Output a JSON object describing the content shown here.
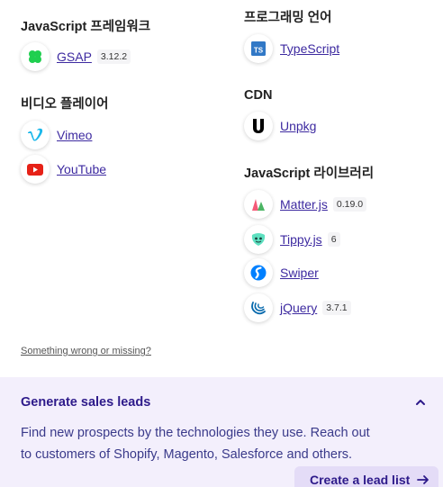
{
  "left_column": {
    "groups": [
      {
        "title": "JavaScript 프레임워크",
        "items": [
          {
            "name": "GSAP",
            "version": "3.12.2",
            "icon": "gsap-icon",
            "color": "#1fcf4f"
          }
        ]
      },
      {
        "title": "비디오 플레이어",
        "items": [
          {
            "name": "Vimeo",
            "version": "",
            "icon": "vimeo-icon",
            "color": "#1ab7ea"
          },
          {
            "name": "YouTube",
            "version": "",
            "icon": "youtube-icon",
            "color": "#e62117"
          }
        ]
      }
    ]
  },
  "right_column": {
    "groups": [
      {
        "title": "프로그래밍 언어",
        "items": [
          {
            "name": "TypeScript",
            "version": "",
            "icon": "typescript-icon",
            "color": "#3178c6",
            "icon_text": "TS"
          }
        ]
      },
      {
        "title": "CDN",
        "items": [
          {
            "name": "Unpkg",
            "version": "",
            "icon": "unpkg-icon",
            "color": "#000000",
            "icon_text": "U"
          }
        ]
      },
      {
        "title": "JavaScript 라이브러리",
        "items": [
          {
            "name": "Matter.js",
            "version": "0.19.0",
            "icon": "matterjs-icon",
            "color": "#4cb564"
          },
          {
            "name": "Tippy.js",
            "version": "6",
            "icon": "tippyjs-icon",
            "color": "#5ee0c0"
          },
          {
            "name": "Swiper",
            "version": "",
            "icon": "swiper-icon",
            "color": "#0080ff"
          },
          {
            "name": "jQuery",
            "version": "3.7.1",
            "icon": "jquery-icon",
            "color": "#0769ad"
          }
        ]
      }
    ]
  },
  "report_link": "Something wrong or missing?",
  "leads": {
    "title": "Generate sales leads",
    "description": "Find new prospects by the technologies they use. Reach out to customers of Shopify, Magento, Salesforce and others.",
    "button_label": "Create a lead list"
  },
  "colors": {
    "link": "#3d2aa0",
    "panel_bg": "#f3effc",
    "button_bg": "#e4dcf7",
    "heading_dark": "#2d1a8a"
  }
}
